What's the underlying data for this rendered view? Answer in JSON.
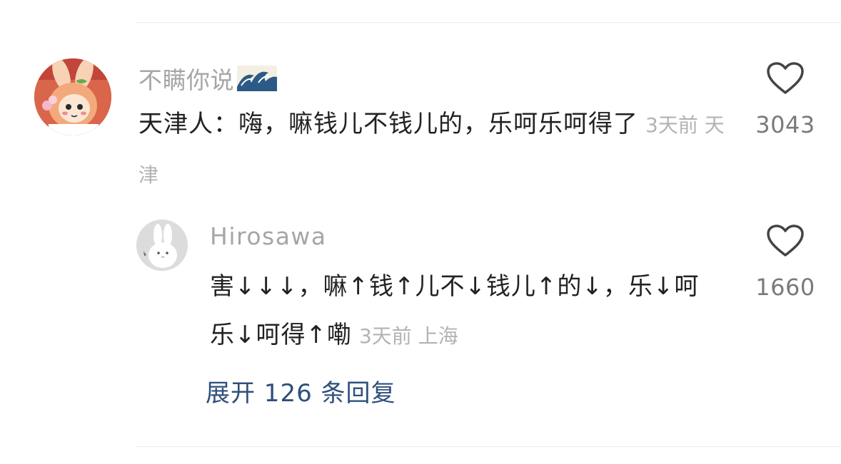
{
  "main_comment": {
    "username": "不瞒你说",
    "badge_icon": "wave-emoji-icon",
    "text": "天津人：嗨，嘛钱儿不钱儿的，乐呵乐呵得了",
    "time": "3天前",
    "location": "天津",
    "likes": "3043"
  },
  "reply": {
    "username": "Hirosawa",
    "text": "害↓↓↓，嘛↑钱↑儿不↓钱儿↑的↓，乐↓呵乐↓呵得↑嘞",
    "time": "3天前",
    "location": "上海",
    "likes": "1660"
  },
  "expand_label": "展开 126 条回复",
  "colors": {
    "username": "#a6a6a6",
    "text": "#222222",
    "meta": "#b3b3b3",
    "like_count": "#7a7a7a",
    "expand_link": "#2f4f7d"
  }
}
